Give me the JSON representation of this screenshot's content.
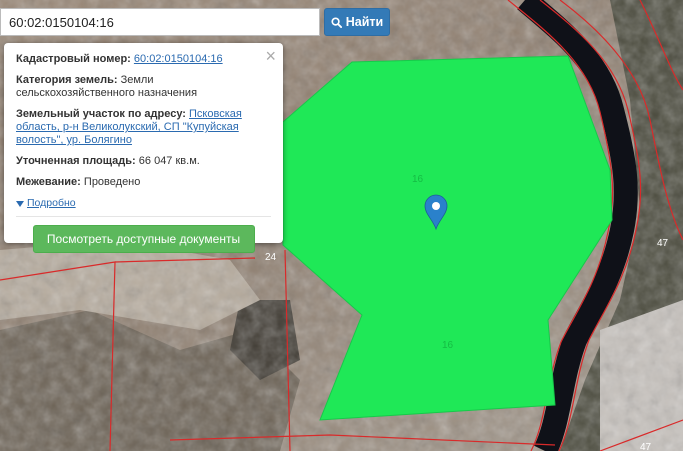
{
  "search": {
    "value": "60:02:0150104:16",
    "button_label": "Найти"
  },
  "popup": {
    "cadastral_label": "Кадастровый номер:",
    "cadastral_value": "60:02:0150104:16",
    "category_label": "Категория земель:",
    "category_value": "Земли сельскохозяйственного назначения",
    "address_label": "Земельный участок по адресу:",
    "address_value": "Псковская область, р-н Великолукский, СП \"Купуйская волость\", ур. Болягино",
    "area_label": "Уточненная площадь:",
    "area_value": "66 047 кв.м.",
    "survey_label": "Межевание:",
    "survey_value": "Проведено",
    "more_link": "Подробно",
    "docs_button": "Посмотреть доступные документы",
    "close_symbol": "×"
  },
  "map": {
    "parcel_label_top": "16",
    "parcel_label_bottom": "16",
    "label_24": "24",
    "label_47_a": "47",
    "label_47_b": "47"
  },
  "colors": {
    "parcel_fill": "#1fe857",
    "boundary": "#d92a2a",
    "marker": "#2a81cb",
    "search_button": "#337ab7",
    "docs_button": "#5cb85c"
  }
}
